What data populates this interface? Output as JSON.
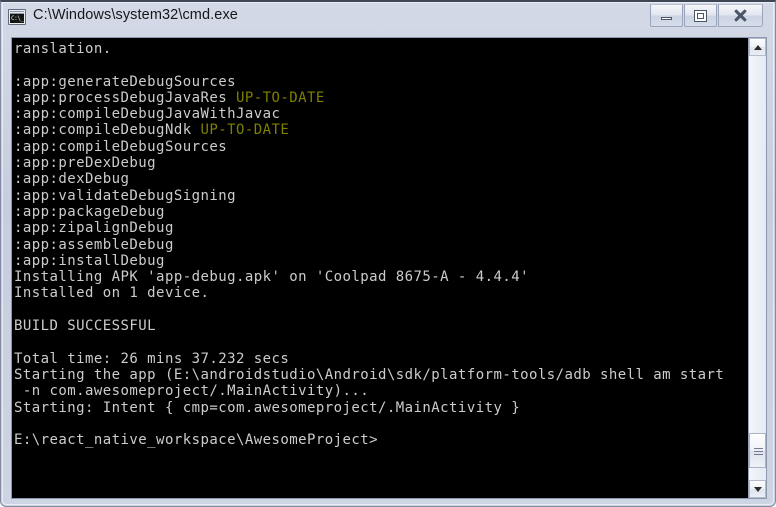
{
  "window": {
    "title": "C:\\Windows\\system32\\cmd.exe",
    "icon_name": "cmd-console-icon",
    "icon_glyph": "C:\\_",
    "controls": {
      "minimize_label": "Minimize",
      "maximize_label": "Maximize",
      "close_label": "Close"
    }
  },
  "colors": {
    "console_background": "#000000",
    "console_foreground": "#cccccc",
    "highlight_yellow": "#7f7f00",
    "titlebar": "#c6cddf",
    "frame_border": "#7f8ba3"
  },
  "console": {
    "lines": [
      {
        "text": "ranslation.",
        "color": "white"
      },
      {
        "text": "",
        "color": "white"
      },
      {
        "text": ":app:generateDebugSources",
        "color": "white"
      },
      {
        "text": ":app:processDebugJavaRes ",
        "color": "white",
        "suffix": "UP-TO-DATE",
        "suffix_color": "yellow"
      },
      {
        "text": ":app:compileDebugJavaWithJavac",
        "color": "white"
      },
      {
        "text": ":app:compileDebugNdk ",
        "color": "white",
        "suffix": "UP-TO-DATE",
        "suffix_color": "yellow"
      },
      {
        "text": ":app:compileDebugSources",
        "color": "white"
      },
      {
        "text": ":app:preDexDebug",
        "color": "white"
      },
      {
        "text": ":app:dexDebug",
        "color": "white"
      },
      {
        "text": ":app:validateDebugSigning",
        "color": "white"
      },
      {
        "text": ":app:packageDebug",
        "color": "white"
      },
      {
        "text": ":app:zipalignDebug",
        "color": "white"
      },
      {
        "text": ":app:assembleDebug",
        "color": "white"
      },
      {
        "text": ":app:installDebug",
        "color": "white"
      },
      {
        "text": "Installing APK 'app-debug.apk' on 'Coolpad 8675-A - 4.4.4'",
        "color": "white"
      },
      {
        "text": "Installed on 1 device.",
        "color": "white"
      },
      {
        "text": "",
        "color": "white"
      },
      {
        "text": "BUILD SUCCESSFUL",
        "color": "white"
      },
      {
        "text": "",
        "color": "white"
      },
      {
        "text": "Total time: 26 mins 37.232 secs",
        "color": "white"
      },
      {
        "text": "Starting the app (E:\\androidstudio\\Android\\sdk/platform-tools/adb shell am start",
        "color": "white"
      },
      {
        "text": " -n com.awesomeproject/.MainActivity)...",
        "color": "white"
      },
      {
        "text": "Starting: Intent { cmp=com.awesomeproject/.MainActivity }",
        "color": "white"
      },
      {
        "text": "",
        "color": "white"
      },
      {
        "text": "E:\\react_native_workspace\\AwesomeProject>",
        "color": "white"
      }
    ]
  },
  "scrollbar": {
    "up_arrow_name": "scroll-up-arrow",
    "down_arrow_name": "scroll-down-arrow",
    "thumb_name": "scroll-thumb",
    "position_percent": 97
  }
}
